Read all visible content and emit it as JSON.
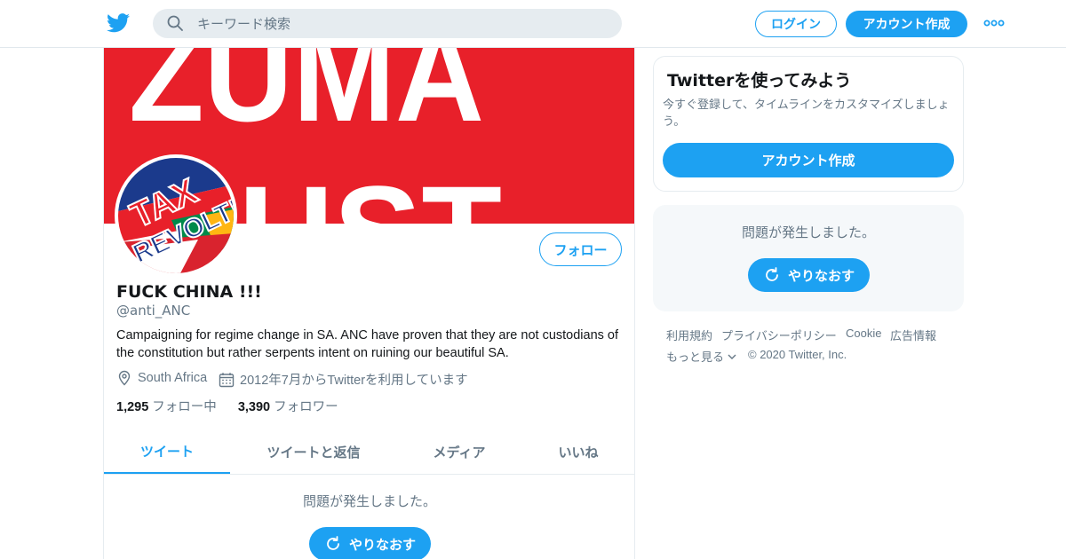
{
  "topbar": {
    "search_placeholder": "キーワード検索",
    "login_label": "ログイン",
    "signup_label": "アカウント作成"
  },
  "banner": {
    "text_line1": "ZUMA",
    "text_line2": "MUST"
  },
  "avatar": {
    "text_line1": "TAX",
    "text_line2": "REVOLT!"
  },
  "profile": {
    "follow_label": "フォロー",
    "name": "FUCK CHINA !!!",
    "handle": "@anti_ANC",
    "bio": "Campaigning for regime change in SA. ANC have proven that they are not custodians of the constitution but rather serpents intent on ruining our beautiful SA.",
    "location": "South Africa",
    "joined": "2012年7月からTwitterを利用しています",
    "following_count": "1,295",
    "following_label": "フォロー中",
    "followers_count": "3,390",
    "followers_label": "フォロワー"
  },
  "tabs": [
    {
      "label": "ツイート",
      "active": true
    },
    {
      "label": "ツイートと返信",
      "active": false
    },
    {
      "label": "メディア",
      "active": false
    },
    {
      "label": "いいね",
      "active": false
    }
  ],
  "timeline": {
    "error_text": "問題が発生しました。",
    "retry_label": "やりなおす"
  },
  "sidebar": {
    "signup_card": {
      "title": "Twitterを使ってみよう",
      "description": "今すぐ登録して、タイムラインをカスタマイズしましょう。",
      "button_label": "アカウント作成"
    },
    "error_card": {
      "error_text": "問題が発生しました。",
      "retry_label": "やりなおす"
    },
    "footer": {
      "links": [
        "利用規約",
        "プライバシーポリシー",
        "Cookie",
        "広告情報"
      ],
      "more_label": "もっと見る",
      "copyright": "© 2020 Twitter, Inc."
    }
  },
  "colors": {
    "accent": "#1da1f2",
    "banner_red": "#e8202a",
    "muted_text": "#657786"
  }
}
